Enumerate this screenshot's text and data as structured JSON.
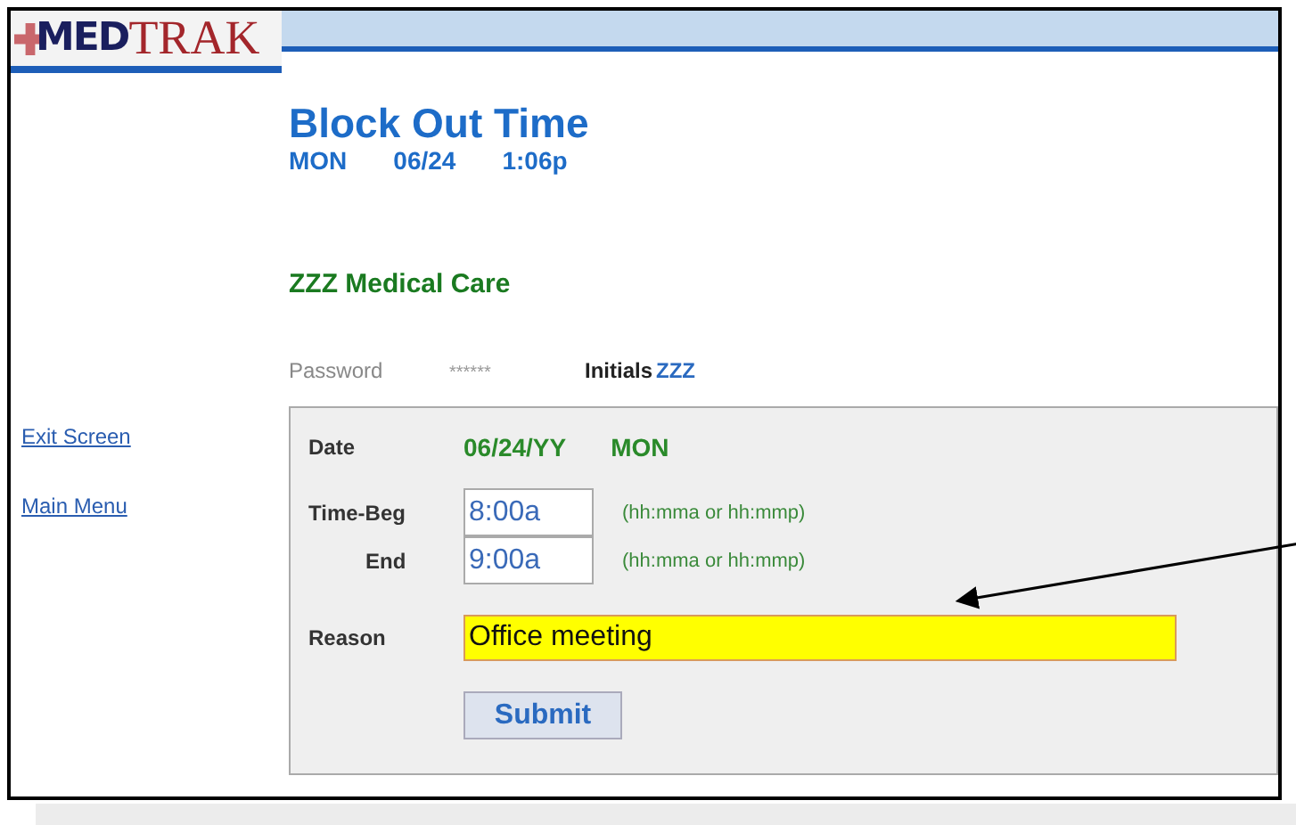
{
  "logo": {
    "prefix": "MED",
    "suffix": "TRAK"
  },
  "page": {
    "title": "Block Out Time",
    "day": "MON",
    "date": "06/24",
    "time": "1:06p"
  },
  "practice": "ZZZ Medical Care",
  "credentials": {
    "password_label": "Password",
    "password_value": "******",
    "initials_label": "Initials",
    "initials_value": "ZZZ"
  },
  "nav": [
    {
      "label": "Exit Screen"
    },
    {
      "label": "Main Menu"
    }
  ],
  "form": {
    "date_label": "Date",
    "date_value": "06/24/YY",
    "day_value": "MON",
    "time_fields": [
      {
        "label": "Time-Beg",
        "value": "8:00a",
        "hint": "(hh:mma or hh:mmp)"
      },
      {
        "label": "End",
        "value": "9:00a",
        "hint": "(hh:mma or hh:mmp)"
      }
    ],
    "reason_label": "Reason",
    "reason_value": "Office meeting",
    "submit": "Submit"
  }
}
